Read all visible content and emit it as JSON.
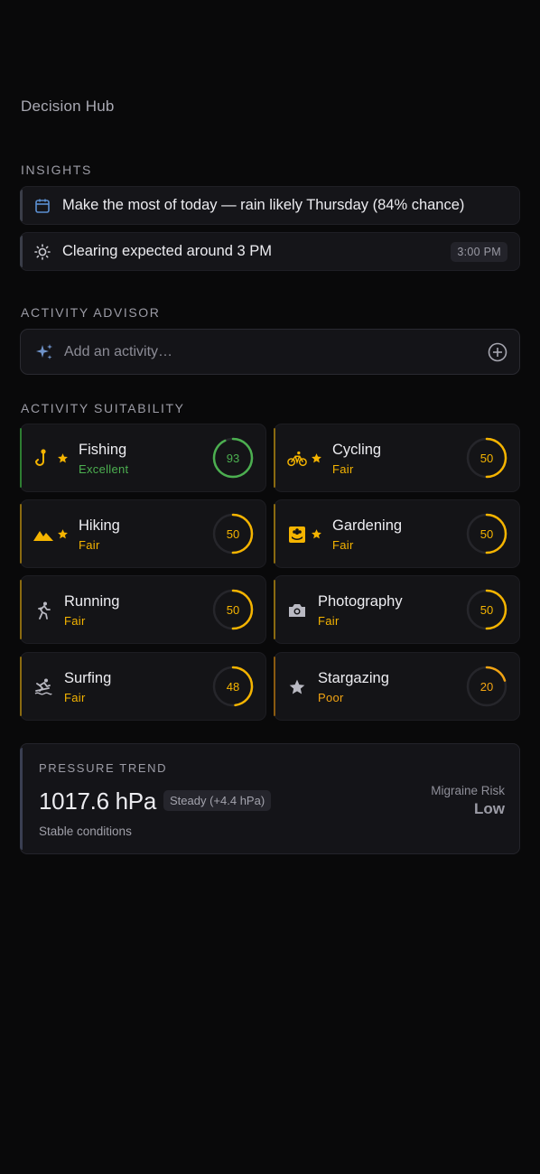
{
  "page": {
    "title": "Decision Hub"
  },
  "insights": {
    "label": "INSIGHTS",
    "items": [
      {
        "icon": "calendar-icon",
        "text": "Make the most of today — rain likely Thursday (84% chance)"
      },
      {
        "icon": "sun-icon",
        "text": "Clearing expected around 3 PM",
        "time": "3:00 PM"
      }
    ]
  },
  "advisor": {
    "label": "ACTIVITY ADVISOR",
    "placeholder": "Add an activity…"
  },
  "suitability": {
    "label": "ACTIVITY SUITABILITY",
    "activities": [
      {
        "name": "Fishing",
        "rating": "Excellent",
        "score": 93,
        "favorite": true,
        "icon": "fishing-hook-icon",
        "color": "#4caf50"
      },
      {
        "name": "Cycling",
        "rating": "Fair",
        "score": 50,
        "favorite": true,
        "icon": "bicycle-icon",
        "color": "#f5b400"
      },
      {
        "name": "Hiking",
        "rating": "Fair",
        "score": 50,
        "favorite": true,
        "icon": "mountain-icon",
        "color": "#f5b400"
      },
      {
        "name": "Gardening",
        "rating": "Fair",
        "score": 50,
        "favorite": true,
        "icon": "flower-icon",
        "color": "#f5b400"
      },
      {
        "name": "Running",
        "rating": "Fair",
        "score": 50,
        "favorite": false,
        "icon": "runner-icon",
        "color": "#f5b400"
      },
      {
        "name": "Photography",
        "rating": "Fair",
        "score": 50,
        "favorite": false,
        "icon": "camera-icon",
        "color": "#f5b400"
      },
      {
        "name": "Surfing",
        "rating": "Fair",
        "score": 48,
        "favorite": false,
        "icon": "surfing-icon",
        "color": "#f5b400"
      },
      {
        "name": "Stargazing",
        "rating": "Poor",
        "score": 20,
        "favorite": false,
        "icon": "star-icon",
        "color": "#f2a413"
      }
    ]
  },
  "pressure": {
    "label": "PRESSURE TREND",
    "value": "1017.6 hPa",
    "trend": "Steady (+4.4 hPa)",
    "description": "Stable conditions",
    "migraine_label": "Migraine Risk",
    "migraine_value": "Low"
  },
  "colors": {
    "accent_good": "#4caf50",
    "accent_fair": "#f5b400",
    "accent_poor": "#f2a413",
    "calendar": "#5b8fd1"
  }
}
